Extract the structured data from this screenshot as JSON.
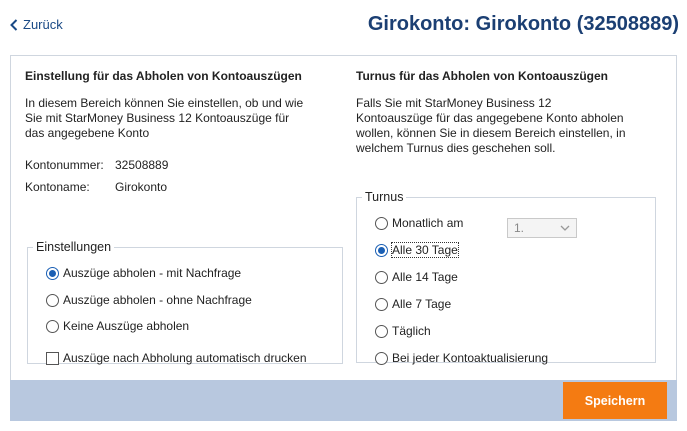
{
  "header": {
    "back_label": "Zurück",
    "title": "Girokonto: Girokonto (32508889)"
  },
  "left": {
    "heading": "Einstellung für das Abholen von Kontoauszügen",
    "description": "In diesem Bereich können Sie einstellen, ob und wie Sie mit StarMoney Business 12 Kontoauszüge für das angegebene Konto",
    "kontonummer_label": "Kontonummer:",
    "kontonummer_value": "32508889",
    "kontoname_label": "Kontoname:",
    "kontoname_value": "Girokonto",
    "settings": {
      "legend": "Einstellungen",
      "options": [
        {
          "label": "Auszüge abholen - mit Nachfrage",
          "selected": true
        },
        {
          "label": "Auszüge abholen - ohne Nachfrage",
          "selected": false
        },
        {
          "label": "Keine Auszüge abholen",
          "selected": false
        }
      ],
      "print_label": "Auszüge nach Abholung automatisch drucken",
      "print_checked": false
    }
  },
  "right": {
    "heading": "Turnus für das Abholen von Kontoauszügen",
    "description": "Falls Sie mit StarMoney Business 12 Kontoauszüge für das angegebene Konto abholen wollen, können Sie in diesem Bereich einstellen, in welchem Turnus dies geschehen soll.",
    "turnus": {
      "legend": "Turnus",
      "options": [
        {
          "label": "Monatlich am",
          "selected": false
        },
        {
          "label": "Alle 30 Tage",
          "selected": true
        },
        {
          "label": "Alle 14 Tage",
          "selected": false
        },
        {
          "label": "Alle 7 Tage",
          "selected": false
        },
        {
          "label": "Täglich",
          "selected": false
        },
        {
          "label": "Bei jeder Kontoaktualisierung",
          "selected": false
        }
      ],
      "day_select_value": "1."
    }
  },
  "footer": {
    "save_label": "Speichern"
  },
  "colors": {
    "title": "#1b3f73",
    "accent_button": "#f47b12",
    "footer_bar": "#b8c8df",
    "radio_selected": "#1a5fb4"
  }
}
